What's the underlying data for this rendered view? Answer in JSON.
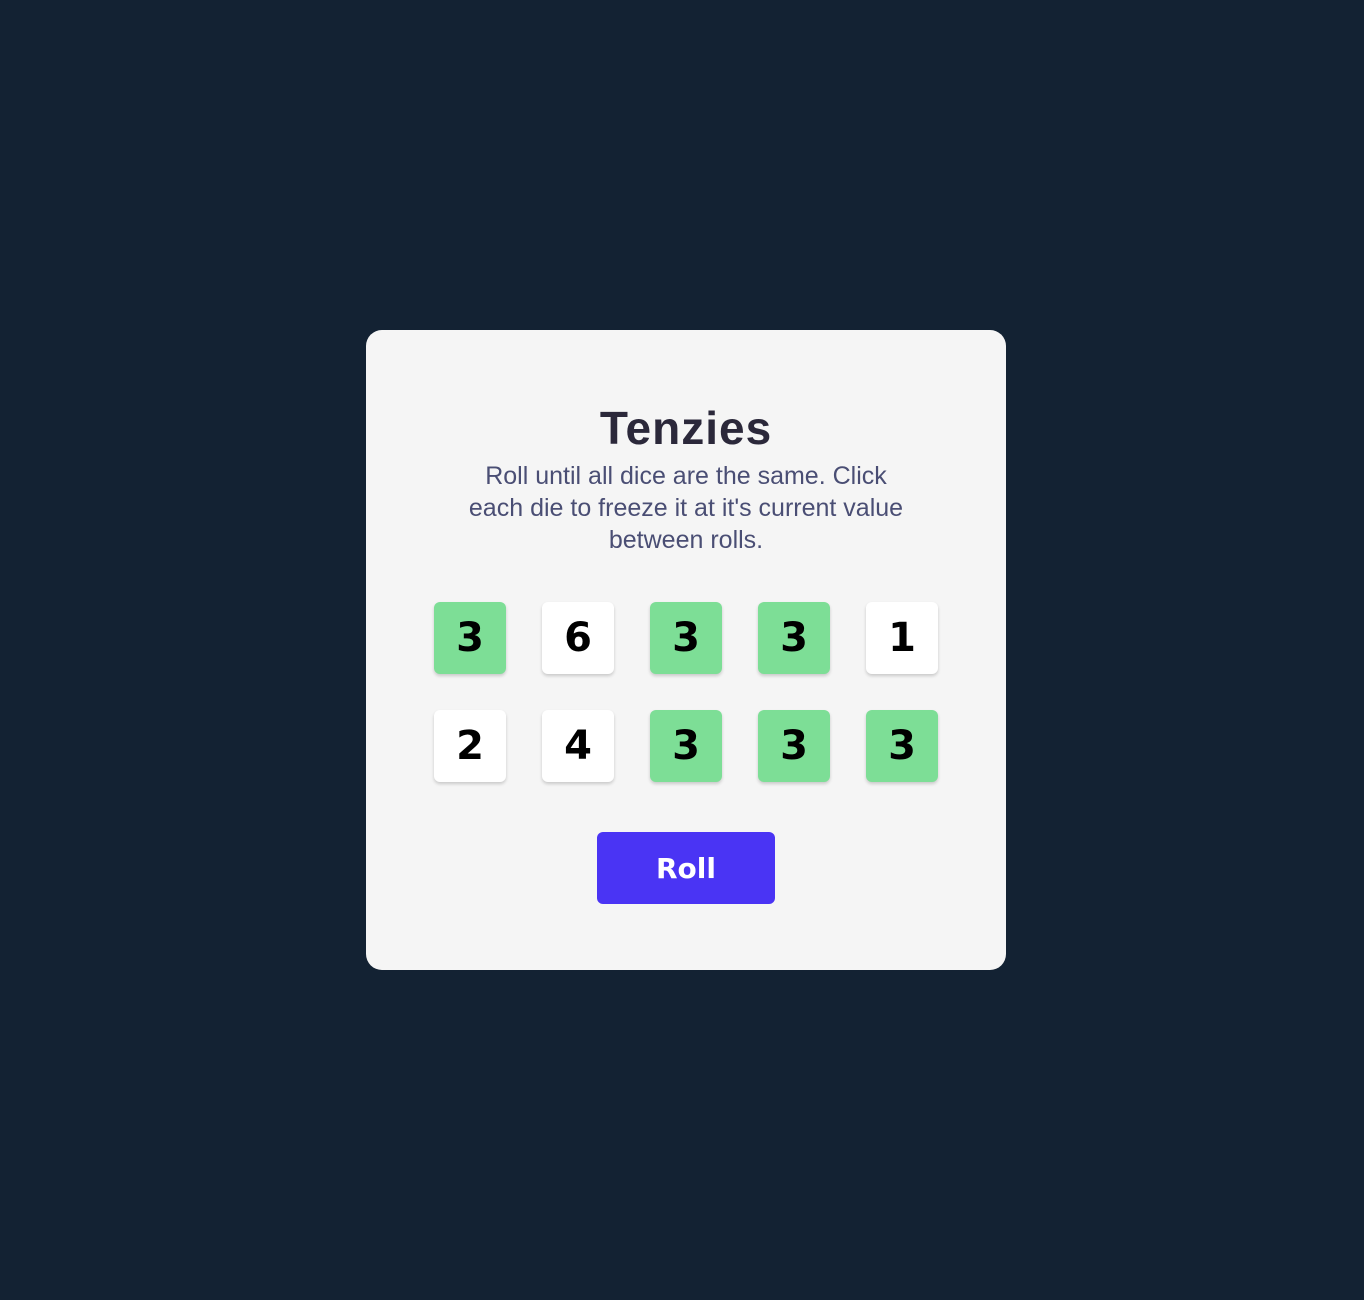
{
  "game": {
    "title": "Tenzies",
    "instructions": [
      "Roll until all dice are the same. Click",
      "each die to freeze it at it's current value",
      "between rolls."
    ],
    "roll_label": "Roll"
  },
  "dice": [
    {
      "value": "3",
      "held": true
    },
    {
      "value": "6",
      "held": false
    },
    {
      "value": "3",
      "held": true
    },
    {
      "value": "3",
      "held": true
    },
    {
      "value": "1",
      "held": false
    },
    {
      "value": "2",
      "held": false
    },
    {
      "value": "4",
      "held": false
    },
    {
      "value": "3",
      "held": true
    },
    {
      "value": "3",
      "held": true
    },
    {
      "value": "3",
      "held": true
    }
  ],
  "colors": {
    "background": "#132233",
    "card": "#f5f5f5",
    "held_die": "#7dde96",
    "free_die": "#ffffff",
    "button": "#4a34f4"
  }
}
